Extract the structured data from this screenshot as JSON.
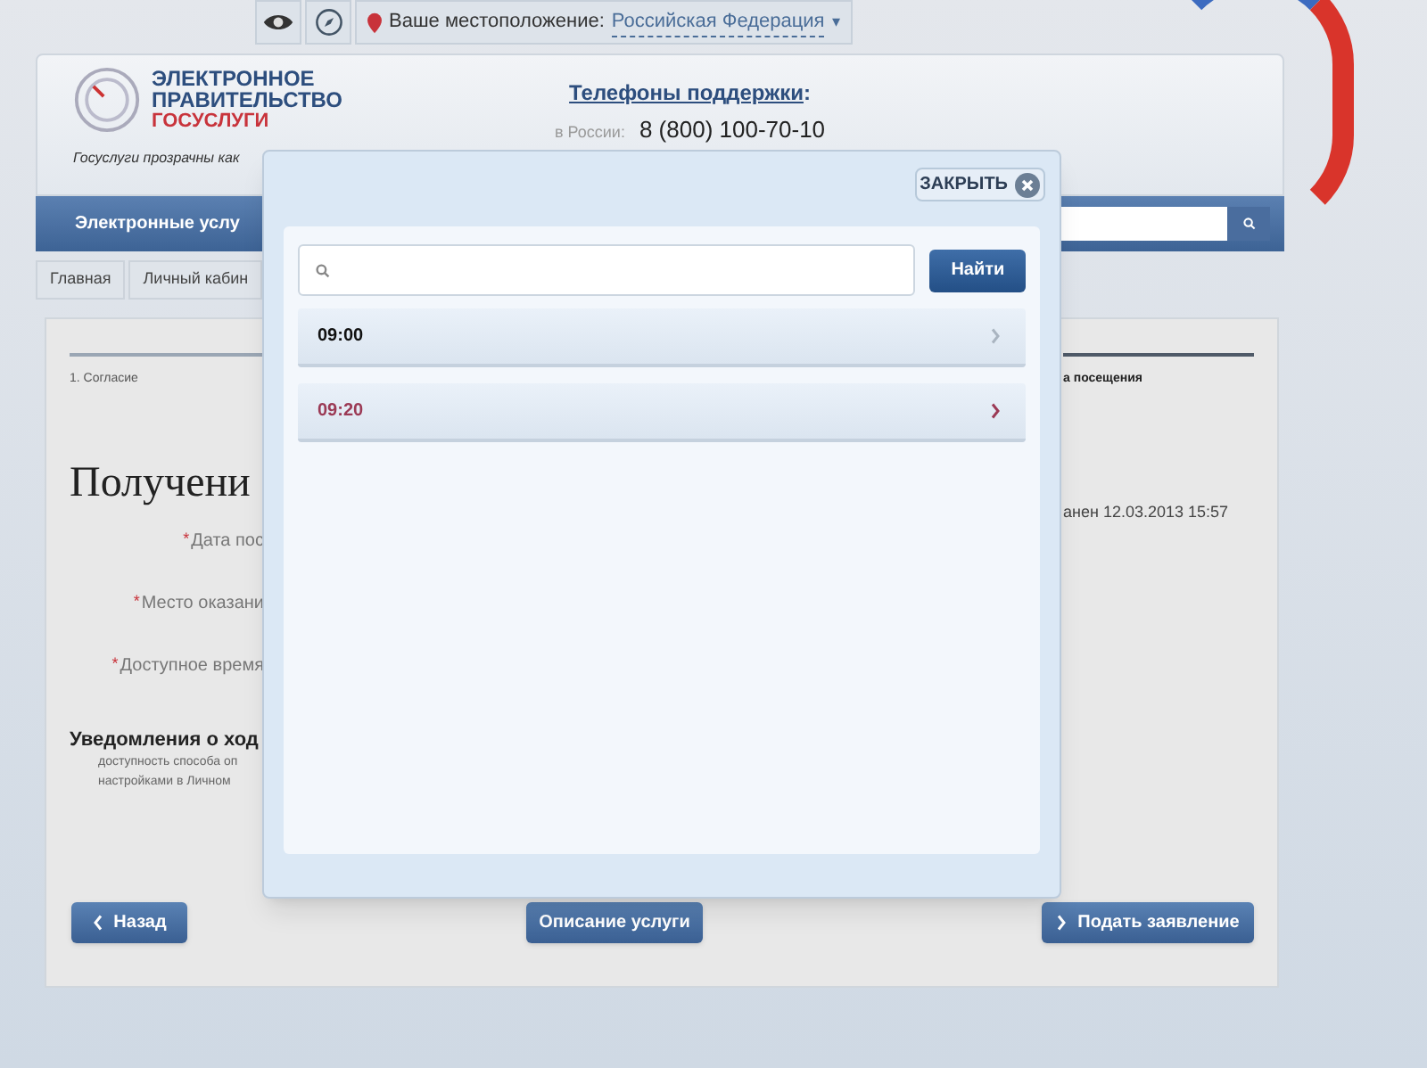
{
  "top_bar": {
    "location_label": "Ваше местоположение:",
    "location_value": "Российская Федерация",
    "location_caret": "▾"
  },
  "header": {
    "logo_line_1": "ЭЛЕКТРОННОЕ",
    "logo_line_2": "ПРАВИТЕЛЬСТВО",
    "logo_line_3": "ГОСУСЛУГИ",
    "tagline": "Госуслуги прозрачны как",
    "support_title": "Телефоны поддержки",
    "support_colon": ":",
    "phone_label": "в России:",
    "phone": "8 (800) 100-70-10"
  },
  "nav": {
    "title": "Электронные услу"
  },
  "breadcrumbs": [
    {
      "label": "Главная"
    },
    {
      "label": "Личный кабин"
    }
  ],
  "form": {
    "steps": [
      {
        "label": "1. Согласие",
        "selected": false
      },
      {
        "label": "а посещения",
        "selected": true
      }
    ],
    "heading": "Получени",
    "saved_note": "анен 12.03.2013 15:57",
    "required_mark": "*",
    "fields": [
      {
        "label": "Дата пос",
        "required": true
      },
      {
        "label": "Место оказани",
        "required": true
      },
      {
        "label": "Доступное время",
        "required": true
      }
    ],
    "notifications_title": "Уведомления о ход",
    "notifications_text": [
      "доступность способа оп",
      "настройками в Личном"
    ],
    "buttons": [
      {
        "label": "Назад",
        "kind": "back"
      },
      {
        "label": "Описание услуги",
        "kind": "plain"
      },
      {
        "label": "Подать заявление",
        "kind": "next"
      }
    ]
  },
  "modal": {
    "close_label": "ЗАКРЫТЬ",
    "search_button": "Найти",
    "times": [
      {
        "label": "09:00",
        "selected": false
      },
      {
        "label": "09:20",
        "selected": true
      }
    ]
  }
}
